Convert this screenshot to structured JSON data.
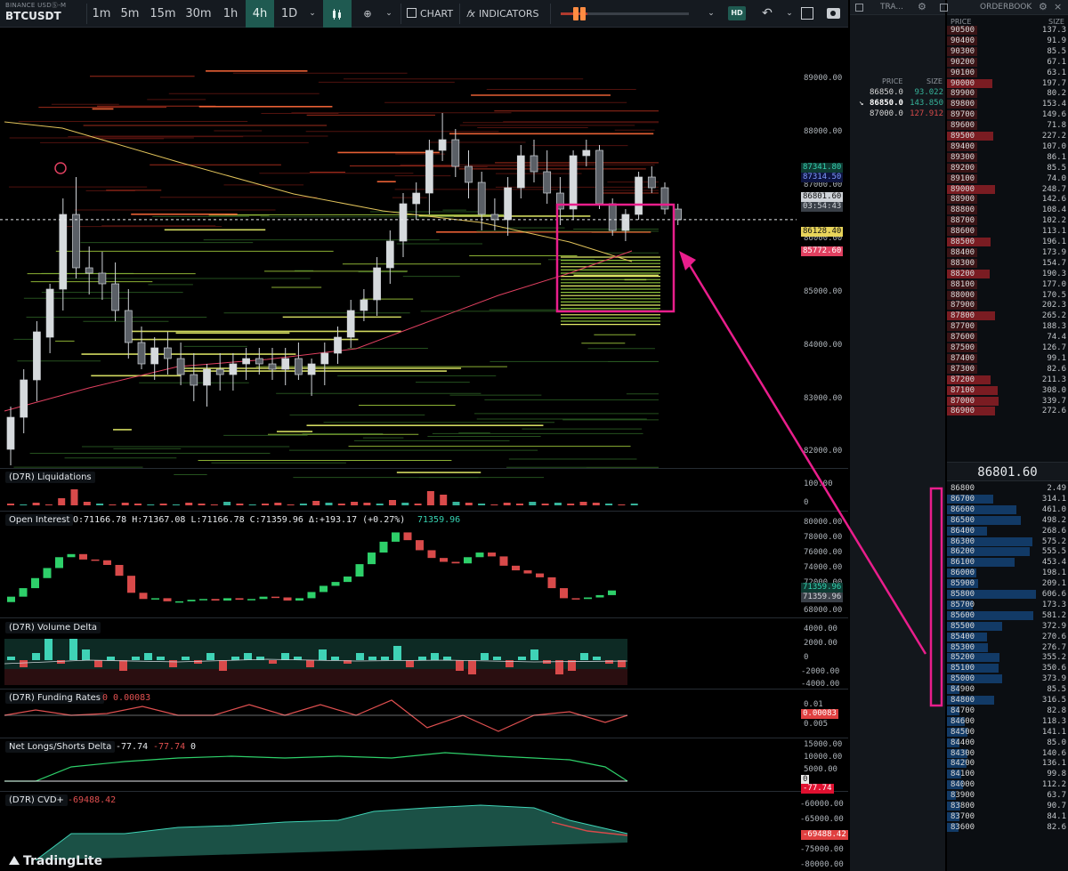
{
  "symbol": {
    "exchange": "BINANCE USDⓈ-M",
    "pair": "BTCUSDT"
  },
  "timeframes": [
    "1m",
    "5m",
    "15m",
    "30m",
    "1h",
    "4h",
    "1D"
  ],
  "active_timeframe": "4h",
  "toolbar": {
    "chart_label": "CHART",
    "indicators_label": "INDICATORS",
    "hd_label": "HD"
  },
  "price_axis": [
    "89000.00",
    "88000.00",
    "87000.00",
    "86000.00",
    "85000.00",
    "84000.00",
    "83000.00",
    "82000.00"
  ],
  "price_tags": {
    "p1": "87341.80",
    "p2": "87314.50",
    "last": "86801.60",
    "countdown": "03:54:43",
    "ma_yellow": "86128.40",
    "ma_red": "85772.60"
  },
  "panes": {
    "liq": {
      "title": "(D7R) Liquidations",
      "axis": [
        "100.00",
        "0"
      ]
    },
    "oi": {
      "title": "Open Interest",
      "ohlc": "O:71166.78 H:71367.08 L:71166.78 C:71359.96 Δ:+193.17 (+0.27%)",
      "last": "71359.96",
      "axis": [
        "80000.00",
        "78000.00",
        "76000.00",
        "74000.00",
        "72000.00",
        "70000.00",
        "68000.00"
      ],
      "tag1": "71359.96",
      "tag2": "71359.96"
    },
    "vd": {
      "title": "(D7R) Volume Delta",
      "axis": [
        "4000.00",
        "2000.00",
        "0",
        "-2000.00",
        "-4000.00"
      ]
    },
    "fr": {
      "title": "(D7R) Funding Rates",
      "vals": "0 0.00083",
      "axis": [
        "0.01",
        "0.005"
      ],
      "tag": "0.00083"
    },
    "nl": {
      "title": "Net Longs/Shorts Delta",
      "v1": "-77.74",
      "v2": "-77.74",
      "v3": "0",
      "axis": [
        "15000.00",
        "10000.00",
        "5000.00",
        "0"
      ],
      "tag1": "0",
      "tag2": "-77.74"
    },
    "cvd": {
      "title": "(D7R) CVD+",
      "vals": "-69488.42",
      "axis": [
        "-60000.00",
        "-65000.00",
        "-70000.00",
        "-75000.00",
        "-80000.00"
      ],
      "tag": "-69488.42"
    }
  },
  "watermark": "TradingLite",
  "trades": {
    "title": "TRA...",
    "col_price": "PRICE",
    "col_size": "SIZE",
    "rows": [
      {
        "price": "86850.0",
        "size": "93.022",
        "color": "#36b39a"
      },
      {
        "price": "86850.0",
        "size": "143.850",
        "color": "#36b39a",
        "bold": true
      },
      {
        "price": "87000.0",
        "size": "127.912",
        "color": "#d84a4a"
      }
    ]
  },
  "orderbook": {
    "title": "ORDERBOOK",
    "col_price": "PRICE",
    "col_size": "SIZE",
    "mid": "86801.60",
    "asks": [
      [
        "90500",
        "137.3",
        0
      ],
      [
        "90400",
        "91.9",
        0.05
      ],
      [
        "90300",
        "85.5",
        0.05
      ],
      [
        "90200",
        "67.1",
        0.04
      ],
      [
        "90100",
        "63.1",
        0.04
      ],
      [
        "90000",
        "197.7",
        0.35
      ],
      [
        "89900",
        "80.2",
        0.05
      ],
      [
        "89800",
        "153.4",
        0.1
      ],
      [
        "89700",
        "149.6",
        0.1
      ],
      [
        "89600",
        "71.8",
        0.04
      ],
      [
        "89500",
        "227.2",
        0.4
      ],
      [
        "89400",
        "107.0",
        0.07
      ],
      [
        "89300",
        "86.1",
        0.05
      ],
      [
        "89200",
        "85.5",
        0.05
      ],
      [
        "89100",
        "74.0",
        0.04
      ],
      [
        "89000",
        "248.7",
        0.45
      ],
      [
        "88900",
        "142.6",
        0.09
      ],
      [
        "88800",
        "108.4",
        0.07
      ],
      [
        "88700",
        "102.2",
        0.06
      ],
      [
        "88600",
        "113.1",
        0.07
      ],
      [
        "88500",
        "196.1",
        0.3
      ],
      [
        "88400",
        "173.9",
        0.12
      ],
      [
        "88300",
        "154.7",
        0.1
      ],
      [
        "88200",
        "190.3",
        0.28
      ],
      [
        "88100",
        "177.0",
        0.12
      ],
      [
        "88000",
        "170.5",
        0.11
      ],
      [
        "87900",
        "202.3",
        0.15
      ],
      [
        "87800",
        "265.2",
        0.45
      ],
      [
        "87700",
        "188.3",
        0.13
      ],
      [
        "87600",
        "74.4",
        0.05
      ],
      [
        "87500",
        "126.7",
        0.09
      ],
      [
        "87400",
        "99.1",
        0.06
      ],
      [
        "87300",
        "82.6",
        0.05
      ],
      [
        "87200",
        "211.3",
        0.3
      ],
      [
        "87100",
        "308.0",
        0.55
      ],
      [
        "87000",
        "339.7",
        0.6
      ],
      [
        "86900",
        "272.6",
        0.45
      ]
    ],
    "bids": [
      [
        "86800",
        "2.49",
        0
      ],
      [
        "86700",
        "314.1",
        0.52
      ],
      [
        "86600",
        "461.0",
        0.78
      ],
      [
        "86500",
        "498.2",
        0.83
      ],
      [
        "86400",
        "268.6",
        0.45
      ],
      [
        "86300",
        "575.2",
        0.96
      ],
      [
        "86200",
        "555.5",
        0.93
      ],
      [
        "86100",
        "453.4",
        0.76
      ],
      [
        "86000",
        "198.1",
        0.33
      ],
      [
        "85900",
        "209.1",
        0.35
      ],
      [
        "85800",
        "606.6",
        1.0
      ],
      [
        "85700",
        "173.3",
        0.29
      ],
      [
        "85600",
        "581.2",
        0.97
      ],
      [
        "85500",
        "372.9",
        0.62
      ],
      [
        "85400",
        "270.6",
        0.45
      ],
      [
        "85300",
        "276.7",
        0.46
      ],
      [
        "85200",
        "355.2",
        0.59
      ],
      [
        "85100",
        "350.6",
        0.58
      ],
      [
        "85000",
        "373.9",
        0.62
      ],
      [
        "84900",
        "85.5",
        0.14
      ],
      [
        "84800",
        "316.5",
        0.53
      ],
      [
        "84700",
        "82.8",
        0.14
      ],
      [
        "84600",
        "118.3",
        0.2
      ],
      [
        "84500",
        "141.1",
        0.23
      ],
      [
        "84400",
        "85.0",
        0.14
      ],
      [
        "84300",
        "140.6",
        0.23
      ],
      [
        "84200",
        "136.1",
        0.22
      ],
      [
        "84100",
        "99.8",
        0.16
      ],
      [
        "84000",
        "112.2",
        0.18
      ],
      [
        "83900",
        "63.7",
        0.1
      ],
      [
        "83800",
        "90.7",
        0.15
      ],
      [
        "83700",
        "84.1",
        0.14
      ],
      [
        "83600",
        "82.6",
        0.13
      ]
    ]
  },
  "colors": {
    "bull": "#36b39a",
    "bear": "#d84a4a",
    "accent": "#e91e8c",
    "ma_yellow": "#e0c25a",
    "ma_red": "#e04060"
  }
}
